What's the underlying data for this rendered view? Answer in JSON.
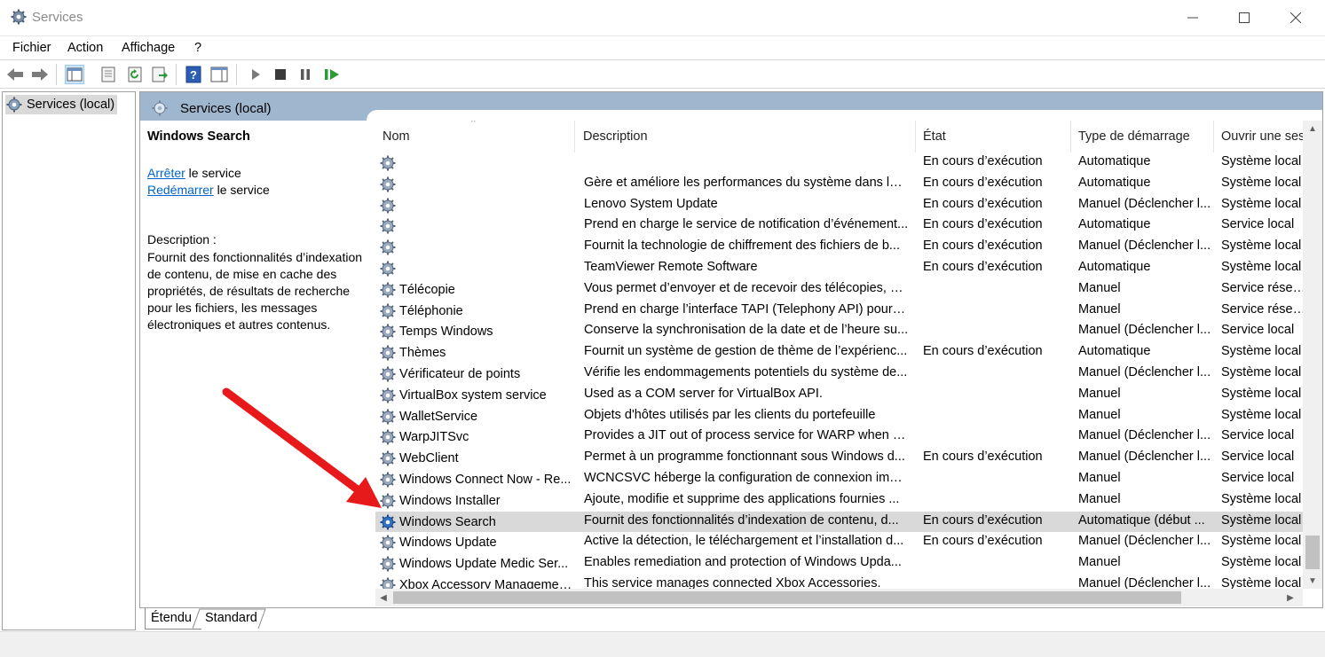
{
  "window": {
    "title": "Services"
  },
  "menu": {
    "items": [
      "Fichier",
      "Action",
      "Affichage",
      "?"
    ]
  },
  "tree": {
    "root_label": "Services (local)"
  },
  "panel": {
    "header_title": "Services (local)",
    "selected_service": "Windows Search",
    "stop_link": "Arrêter",
    "stop_suffix": " le service",
    "restart_link": "Redémarrer",
    "restart_suffix": " le service",
    "description_label": "Description :",
    "description_text": "Fournit des fonctionnalités d’indexation de contenu, de mise en cache des propriétés, de résultats de recherche pour les fichiers, les messages électroniques et autres contenus."
  },
  "table": {
    "columns": [
      "Nom",
      "Description",
      "État",
      "Type de démarrage",
      "Ouvrir une ses"
    ],
    "rows": [
      {
        "name": "",
        "desc": "",
        "state": "En cours d’exécution",
        "start": "Automatique",
        "open": "Système local"
      },
      {
        "name": "",
        "desc": "Gère et améliore les performances du système dans le t...",
        "state": "En cours d’exécution",
        "start": "Automatique",
        "open": "Système local"
      },
      {
        "name": "",
        "desc": "Lenovo System Update",
        "state": "En cours d’exécution",
        "start": "Manuel (Déclencher l...",
        "open": "Système local"
      },
      {
        "name": "",
        "desc": "Prend en charge le service de notification d’événement...",
        "state": "En cours d’exécution",
        "start": "Automatique",
        "open": "Service local"
      },
      {
        "name": "",
        "desc": "Fournit la technologie de chiffrement des fichiers de b...",
        "state": "En cours d’exécution",
        "start": "Manuel (Déclencher l...",
        "open": "Système local"
      },
      {
        "name": "",
        "desc": "TeamViewer Remote Software",
        "state": "En cours d’exécution",
        "start": "Automatique",
        "open": "Système local"
      },
      {
        "name": "Télécopie",
        "desc": "Vous permet d’envoyer et de recevoir des télécopies, d’...",
        "state": "",
        "start": "Manuel",
        "open": "Service réseau"
      },
      {
        "name": "Téléphonie",
        "desc": "Prend en charge l’interface TAPI (Telephony API) pour le...",
        "state": "",
        "start": "Manuel",
        "open": "Service réseau"
      },
      {
        "name": "Temps Windows",
        "desc": "Conserve la synchronisation de la date et de l’heure su...",
        "state": "",
        "start": "Manuel (Déclencher l...",
        "open": "Service local"
      },
      {
        "name": "Thèmes",
        "desc": "Fournit un système de gestion de thème de l’expérienc...",
        "state": "En cours d’exécution",
        "start": "Automatique",
        "open": "Système local"
      },
      {
        "name": "Vérificateur de points",
        "desc": "Vérifie les endommagements potentiels du système de...",
        "state": "",
        "start": "Manuel (Déclencher l...",
        "open": "Système local"
      },
      {
        "name": "VirtualBox system service",
        "desc": "Used as a COM server for VirtualBox API.",
        "state": "",
        "start": "Manuel",
        "open": "Système local"
      },
      {
        "name": "WalletService",
        "desc": "Objets d'hôtes utilisés par les clients du portefeuille",
        "state": "",
        "start": "Manuel",
        "open": "Système local"
      },
      {
        "name": "WarpJITSvc",
        "desc": "Provides a JIT out of process service for WARP when ru...",
        "state": "",
        "start": "Manuel (Déclencher l...",
        "open": "Service local"
      },
      {
        "name": "WebClient",
        "desc": "Permet à un programme fonctionnant sous Windows d...",
        "state": "En cours d’exécution",
        "start": "Manuel (Déclencher l...",
        "open": "Service local"
      },
      {
        "name": "Windows Connect Now - Re...",
        "desc": "WCNCSVC héberge la configuration de connexion imm...",
        "state": "",
        "start": "Manuel",
        "open": "Service local"
      },
      {
        "name": "Windows Installer",
        "desc": "Ajoute, modifie et supprime des applications fournies ...",
        "state": "",
        "start": "Manuel",
        "open": "Système local"
      },
      {
        "name": "Windows Search",
        "desc": "Fournit des fonctionnalités d’indexation de contenu, d...",
        "state": "En cours d’exécution",
        "start": "Automatique (début ...",
        "open": "Système local",
        "selected": true
      },
      {
        "name": "Windows Update",
        "desc": "Active la détection, le téléchargement et l’installation d...",
        "state": "En cours d’exécution",
        "start": "Manuel (Déclencher l...",
        "open": "Système local"
      },
      {
        "name": "Windows Update Medic Ser...",
        "desc": "Enables remediation and protection of Windows Upda...",
        "state": "",
        "start": "Manuel",
        "open": "Système local"
      },
      {
        "name": "Xbox Accessory Managemen...",
        "desc": "This service manages connected Xbox Accessories.",
        "state": "",
        "start": "Manuel (Déclencher l...",
        "open": "Système local"
      }
    ]
  },
  "tabs": {
    "extended": "Étendu",
    "standard": "Standard"
  },
  "colors": {
    "panel_header": "#9fb6cf",
    "selected_row": "#d9d9d9",
    "link": "#0066cc",
    "annotation_arrow": "#e8191a"
  }
}
